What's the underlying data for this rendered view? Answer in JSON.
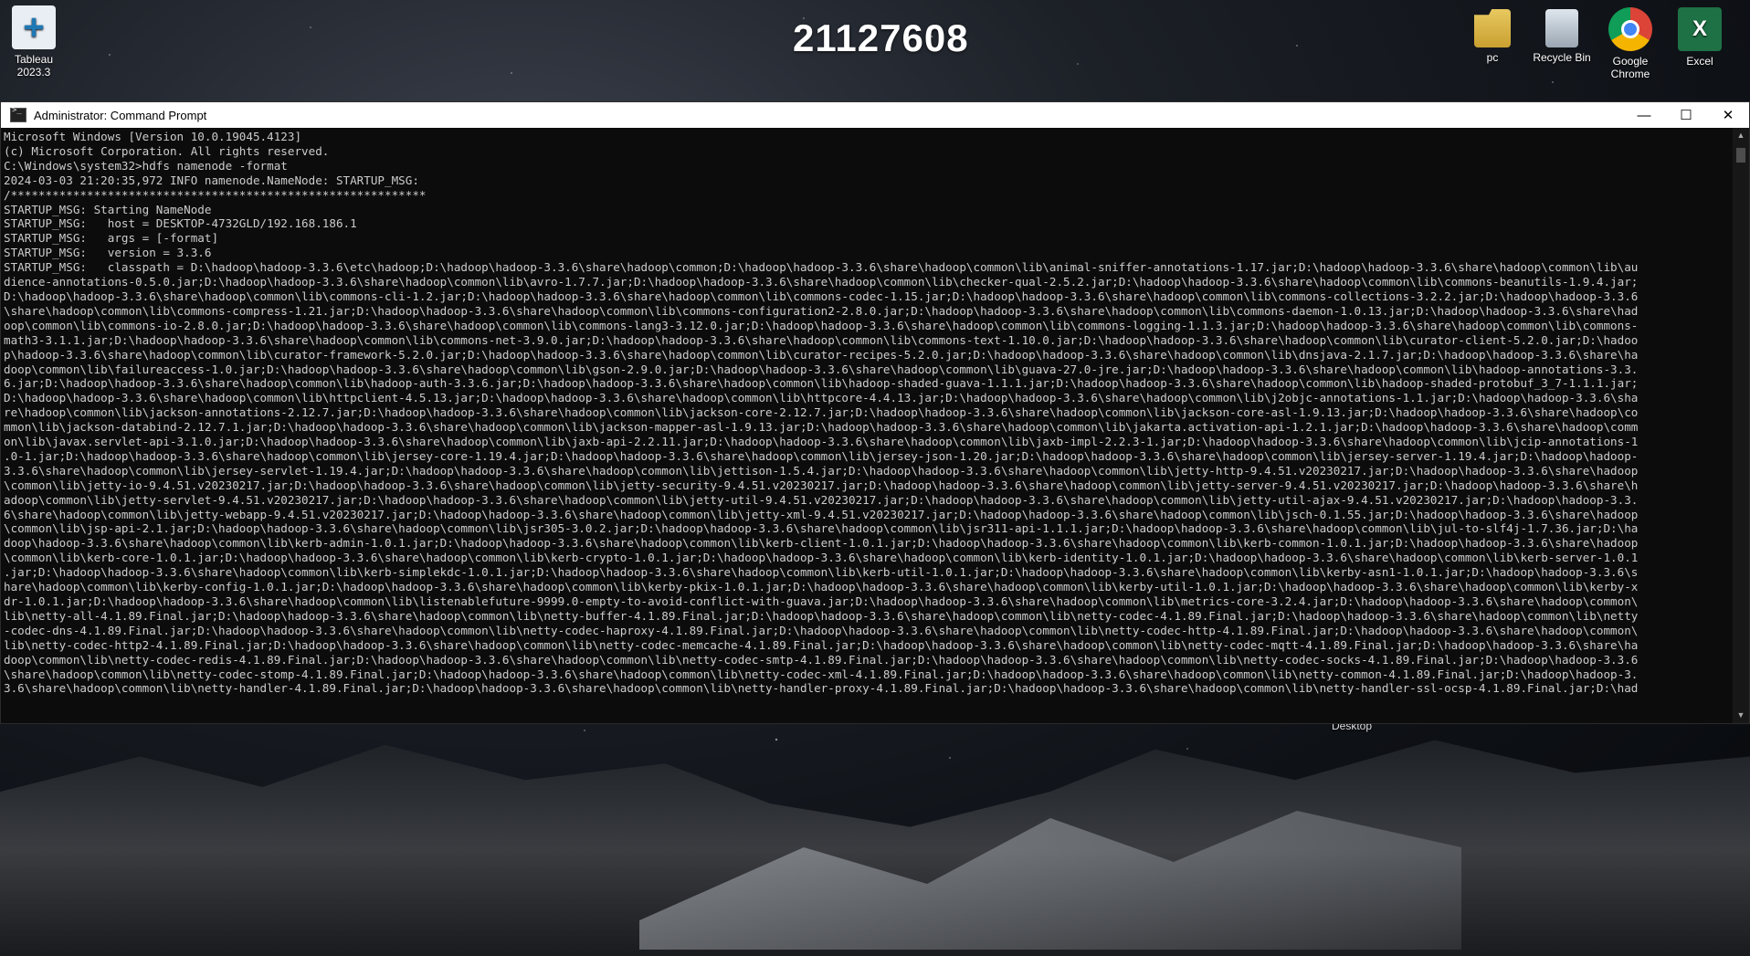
{
  "desktop": {
    "clock_number": "21127608",
    "peek_label": "Desktop",
    "icons": [
      {
        "label": "Tableau\n2023.3",
        "name": "tableau-app-icon"
      },
      {
        "label": "pc",
        "name": "pc-folder-icon"
      },
      {
        "label": "Recycle Bin",
        "name": "recycle-bin-icon"
      },
      {
        "label": "Google\nChrome",
        "name": "chrome-icon"
      },
      {
        "label": "Excel",
        "name": "excel-icon"
      }
    ]
  },
  "window": {
    "title": "Administrator: Command Prompt",
    "minimize": "—",
    "maximize": "☐",
    "close": "✕",
    "lines": [
      "Microsoft Windows [Version 10.0.19045.4123]",
      "(c) Microsoft Corporation. All rights reserved.",
      "",
      "C:\\Windows\\system32>hdfs namenode -format",
      "2024-03-03 21:20:35,972 INFO namenode.NameNode: STARTUP_MSG:",
      "/************************************************************",
      "STARTUP_MSG: Starting NameNode",
      "STARTUP_MSG:   host = DESKTOP-4732GLD/192.168.186.1",
      "STARTUP_MSG:   args = [-format]",
      "STARTUP_MSG:   version = 3.3.6",
      "STARTUP_MSG:   classpath = D:\\hadoop\\hadoop-3.3.6\\etc\\hadoop;D:\\hadoop\\hadoop-3.3.6\\share\\hadoop\\common;D:\\hadoop\\hadoop-3.3.6\\share\\hadoop\\common\\lib\\animal-sniffer-annotations-1.17.jar;D:\\hadoop\\hadoop-3.3.6\\share\\hadoop\\common\\lib\\au",
      "dience-annotations-0.5.0.jar;D:\\hadoop\\hadoop-3.3.6\\share\\hadoop\\common\\lib\\avro-1.7.7.jar;D:\\hadoop\\hadoop-3.3.6\\share\\hadoop\\common\\lib\\checker-qual-2.5.2.jar;D:\\hadoop\\hadoop-3.3.6\\share\\hadoop\\common\\lib\\commons-beanutils-1.9.4.jar;",
      "D:\\hadoop\\hadoop-3.3.6\\share\\hadoop\\common\\lib\\commons-cli-1.2.jar;D:\\hadoop\\hadoop-3.3.6\\share\\hadoop\\common\\lib\\commons-codec-1.15.jar;D:\\hadoop\\hadoop-3.3.6\\share\\hadoop\\common\\lib\\commons-collections-3.2.2.jar;D:\\hadoop\\hadoop-3.3.6",
      "\\share\\hadoop\\common\\lib\\commons-compress-1.21.jar;D:\\hadoop\\hadoop-3.3.6\\share\\hadoop\\common\\lib\\commons-configuration2-2.8.0.jar;D:\\hadoop\\hadoop-3.3.6\\share\\hadoop\\common\\lib\\commons-daemon-1.0.13.jar;D:\\hadoop\\hadoop-3.3.6\\share\\had",
      "oop\\common\\lib\\commons-io-2.8.0.jar;D:\\hadoop\\hadoop-3.3.6\\share\\hadoop\\common\\lib\\commons-lang3-3.12.0.jar;D:\\hadoop\\hadoop-3.3.6\\share\\hadoop\\common\\lib\\commons-logging-1.1.3.jar;D:\\hadoop\\hadoop-3.3.6\\share\\hadoop\\common\\lib\\commons-",
      "math3-3.1.1.jar;D:\\hadoop\\hadoop-3.3.6\\share\\hadoop\\common\\lib\\commons-net-3.9.0.jar;D:\\hadoop\\hadoop-3.3.6\\share\\hadoop\\common\\lib\\commons-text-1.10.0.jar;D:\\hadoop\\hadoop-3.3.6\\share\\hadoop\\common\\lib\\curator-client-5.2.0.jar;D:\\hadoo",
      "p\\hadoop-3.3.6\\share\\hadoop\\common\\lib\\curator-framework-5.2.0.jar;D:\\hadoop\\hadoop-3.3.6\\share\\hadoop\\common\\lib\\curator-recipes-5.2.0.jar;D:\\hadoop\\hadoop-3.3.6\\share\\hadoop\\common\\lib\\dnsjava-2.1.7.jar;D:\\hadoop\\hadoop-3.3.6\\share\\ha",
      "doop\\common\\lib\\failureaccess-1.0.jar;D:\\hadoop\\hadoop-3.3.6\\share\\hadoop\\common\\lib\\gson-2.9.0.jar;D:\\hadoop\\hadoop-3.3.6\\share\\hadoop\\common\\lib\\guava-27.0-jre.jar;D:\\hadoop\\hadoop-3.3.6\\share\\hadoop\\common\\lib\\hadoop-annotations-3.3.",
      "6.jar;D:\\hadoop\\hadoop-3.3.6\\share\\hadoop\\common\\lib\\hadoop-auth-3.3.6.jar;D:\\hadoop\\hadoop-3.3.6\\share\\hadoop\\common\\lib\\hadoop-shaded-guava-1.1.1.jar;D:\\hadoop\\hadoop-3.3.6\\share\\hadoop\\common\\lib\\hadoop-shaded-protobuf_3_7-1.1.1.jar;",
      "D:\\hadoop\\hadoop-3.3.6\\share\\hadoop\\common\\lib\\httpclient-4.5.13.jar;D:\\hadoop\\hadoop-3.3.6\\share\\hadoop\\common\\lib\\httpcore-4.4.13.jar;D:\\hadoop\\hadoop-3.3.6\\share\\hadoop\\common\\lib\\j2objc-annotations-1.1.jar;D:\\hadoop\\hadoop-3.3.6\\sha",
      "re\\hadoop\\common\\lib\\jackson-annotations-2.12.7.jar;D:\\hadoop\\hadoop-3.3.6\\share\\hadoop\\common\\lib\\jackson-core-2.12.7.jar;D:\\hadoop\\hadoop-3.3.6\\share\\hadoop\\common\\lib\\jackson-core-asl-1.9.13.jar;D:\\hadoop\\hadoop-3.3.6\\share\\hadoop\\co",
      "mmon\\lib\\jackson-databind-2.12.7.1.jar;D:\\hadoop\\hadoop-3.3.6\\share\\hadoop\\common\\lib\\jackson-mapper-asl-1.9.13.jar;D:\\hadoop\\hadoop-3.3.6\\share\\hadoop\\common\\lib\\jakarta.activation-api-1.2.1.jar;D:\\hadoop\\hadoop-3.3.6\\share\\hadoop\\comm",
      "on\\lib\\javax.servlet-api-3.1.0.jar;D:\\hadoop\\hadoop-3.3.6\\share\\hadoop\\common\\lib\\jaxb-api-2.2.11.jar;D:\\hadoop\\hadoop-3.3.6\\share\\hadoop\\common\\lib\\jaxb-impl-2.2.3-1.jar;D:\\hadoop\\hadoop-3.3.6\\share\\hadoop\\common\\lib\\jcip-annotations-1",
      ".0-1.jar;D:\\hadoop\\hadoop-3.3.6\\share\\hadoop\\common\\lib\\jersey-core-1.19.4.jar;D:\\hadoop\\hadoop-3.3.6\\share\\hadoop\\common\\lib\\jersey-json-1.20.jar;D:\\hadoop\\hadoop-3.3.6\\share\\hadoop\\common\\lib\\jersey-server-1.19.4.jar;D:\\hadoop\\hadoop-",
      "3.3.6\\share\\hadoop\\common\\lib\\jersey-servlet-1.19.4.jar;D:\\hadoop\\hadoop-3.3.6\\share\\hadoop\\common\\lib\\jettison-1.5.4.jar;D:\\hadoop\\hadoop-3.3.6\\share\\hadoop\\common\\lib\\jetty-http-9.4.51.v20230217.jar;D:\\hadoop\\hadoop-3.3.6\\share\\hadoop",
      "\\common\\lib\\jetty-io-9.4.51.v20230217.jar;D:\\hadoop\\hadoop-3.3.6\\share\\hadoop\\common\\lib\\jetty-security-9.4.51.v20230217.jar;D:\\hadoop\\hadoop-3.3.6\\share\\hadoop\\common\\lib\\jetty-server-9.4.51.v20230217.jar;D:\\hadoop\\hadoop-3.3.6\\share\\h",
      "adoop\\common\\lib\\jetty-servlet-9.4.51.v20230217.jar;D:\\hadoop\\hadoop-3.3.6\\share\\hadoop\\common\\lib\\jetty-util-9.4.51.v20230217.jar;D:\\hadoop\\hadoop-3.3.6\\share\\hadoop\\common\\lib\\jetty-util-ajax-9.4.51.v20230217.jar;D:\\hadoop\\hadoop-3.3.",
      "6\\share\\hadoop\\common\\lib\\jetty-webapp-9.4.51.v20230217.jar;D:\\hadoop\\hadoop-3.3.6\\share\\hadoop\\common\\lib\\jetty-xml-9.4.51.v20230217.jar;D:\\hadoop\\hadoop-3.3.6\\share\\hadoop\\common\\lib\\jsch-0.1.55.jar;D:\\hadoop\\hadoop-3.3.6\\share\\hadoop",
      "\\common\\lib\\jsp-api-2.1.jar;D:\\hadoop\\hadoop-3.3.6\\share\\hadoop\\common\\lib\\jsr305-3.0.2.jar;D:\\hadoop\\hadoop-3.3.6\\share\\hadoop\\common\\lib\\jsr311-api-1.1.1.jar;D:\\hadoop\\hadoop-3.3.6\\share\\hadoop\\common\\lib\\jul-to-slf4j-1.7.36.jar;D:\\ha",
      "doop\\hadoop-3.3.6\\share\\hadoop\\common\\lib\\kerb-admin-1.0.1.jar;D:\\hadoop\\hadoop-3.3.6\\share\\hadoop\\common\\lib\\kerb-client-1.0.1.jar;D:\\hadoop\\hadoop-3.3.6\\share\\hadoop\\common\\lib\\kerb-common-1.0.1.jar;D:\\hadoop\\hadoop-3.3.6\\share\\hadoop",
      "\\common\\lib\\kerb-core-1.0.1.jar;D:\\hadoop\\hadoop-3.3.6\\share\\hadoop\\common\\lib\\kerb-crypto-1.0.1.jar;D:\\hadoop\\hadoop-3.3.6\\share\\hadoop\\common\\lib\\kerb-identity-1.0.1.jar;D:\\hadoop\\hadoop-3.3.6\\share\\hadoop\\common\\lib\\kerb-server-1.0.1",
      ".jar;D:\\hadoop\\hadoop-3.3.6\\share\\hadoop\\common\\lib\\kerb-simplekdc-1.0.1.jar;D:\\hadoop\\hadoop-3.3.6\\share\\hadoop\\common\\lib\\kerb-util-1.0.1.jar;D:\\hadoop\\hadoop-3.3.6\\share\\hadoop\\common\\lib\\kerby-asn1-1.0.1.jar;D:\\hadoop\\hadoop-3.3.6\\s",
      "hare\\hadoop\\common\\lib\\kerby-config-1.0.1.jar;D:\\hadoop\\hadoop-3.3.6\\share\\hadoop\\common\\lib\\kerby-pkix-1.0.1.jar;D:\\hadoop\\hadoop-3.3.6\\share\\hadoop\\common\\lib\\kerby-util-1.0.1.jar;D:\\hadoop\\hadoop-3.3.6\\share\\hadoop\\common\\lib\\kerby-x",
      "dr-1.0.1.jar;D:\\hadoop\\hadoop-3.3.6\\share\\hadoop\\common\\lib\\listenablefuture-9999.0-empty-to-avoid-conflict-with-guava.jar;D:\\hadoop\\hadoop-3.3.6\\share\\hadoop\\common\\lib\\metrics-core-3.2.4.jar;D:\\hadoop\\hadoop-3.3.6\\share\\hadoop\\common\\",
      "lib\\netty-all-4.1.89.Final.jar;D:\\hadoop\\hadoop-3.3.6\\share\\hadoop\\common\\lib\\netty-buffer-4.1.89.Final.jar;D:\\hadoop\\hadoop-3.3.6\\share\\hadoop\\common\\lib\\netty-codec-4.1.89.Final.jar;D:\\hadoop\\hadoop-3.3.6\\share\\hadoop\\common\\lib\\netty",
      "-codec-dns-4.1.89.Final.jar;D:\\hadoop\\hadoop-3.3.6\\share\\hadoop\\common\\lib\\netty-codec-haproxy-4.1.89.Final.jar;D:\\hadoop\\hadoop-3.3.6\\share\\hadoop\\common\\lib\\netty-codec-http-4.1.89.Final.jar;D:\\hadoop\\hadoop-3.3.6\\share\\hadoop\\common\\",
      "lib\\netty-codec-http2-4.1.89.Final.jar;D:\\hadoop\\hadoop-3.3.6\\share\\hadoop\\common\\lib\\netty-codec-memcache-4.1.89.Final.jar;D:\\hadoop\\hadoop-3.3.6\\share\\hadoop\\common\\lib\\netty-codec-mqtt-4.1.89.Final.jar;D:\\hadoop\\hadoop-3.3.6\\share\\ha",
      "doop\\common\\lib\\netty-codec-redis-4.1.89.Final.jar;D:\\hadoop\\hadoop-3.3.6\\share\\hadoop\\common\\lib\\netty-codec-smtp-4.1.89.Final.jar;D:\\hadoop\\hadoop-3.3.6\\share\\hadoop\\common\\lib\\netty-codec-socks-4.1.89.Final.jar;D:\\hadoop\\hadoop-3.3.6",
      "\\share\\hadoop\\common\\lib\\netty-codec-stomp-4.1.89.Final.jar;D:\\hadoop\\hadoop-3.3.6\\share\\hadoop\\common\\lib\\netty-codec-xml-4.1.89.Final.jar;D:\\hadoop\\hadoop-3.3.6\\share\\hadoop\\common\\lib\\netty-common-4.1.89.Final.jar;D:\\hadoop\\hadoop-3.",
      "3.6\\share\\hadoop\\common\\lib\\netty-handler-4.1.89.Final.jar;D:\\hadoop\\hadoop-3.3.6\\share\\hadoop\\common\\lib\\netty-handler-proxy-4.1.89.Final.jar;D:\\hadoop\\hadoop-3.3.6\\share\\hadoop\\common\\lib\\netty-handler-ssl-ocsp-4.1.89.Final.jar;D:\\had"
    ]
  }
}
